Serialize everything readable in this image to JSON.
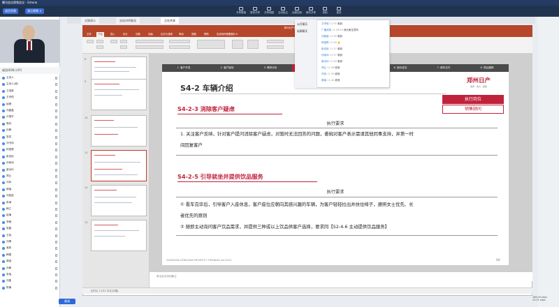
{
  "window": {
    "title": "腾讯会议视频会议 - Gstarw"
  },
  "topbar": {
    "left_buttons": [
      "成员列表",
      "演示视频 ×"
    ],
    "tools": [
      "共享屏幕",
      "暂停共享",
      "共享视图",
      "互动批注",
      "远程控制",
      "新的共享",
      "录制",
      "更多"
    ]
  },
  "left_panel": {
    "members_header": "成员(636) (47)",
    "members": [
      "主持人",
      "主持人(我)",
      "卫浩新",
      "王宗恒",
      "赵峰",
      "刘鑫鑫",
      "卢振宇",
      "周庆",
      "孙静",
      "张宏",
      "刘书伟",
      "柯宝根",
      "彭佳怡",
      "孙雨诗",
      "梁冰玲",
      "郑云",
      "刘伟",
      "郭蓓",
      "刘苗苗",
      "朱琦",
      "韩立",
      "赵楠",
      "李峰",
      "张磊",
      "王晓",
      "刘倩",
      "吴彬",
      "韩雪",
      "郭强",
      "孙峰",
      "张瑶",
      "刘星",
      "陈楠"
    ],
    "invite_button": "邀请"
  },
  "browser_tabs": [
    "文稿演示",
    "说说讲师解读",
    "正在共享"
  ],
  "ppt": {
    "window_title": "郑州日产销售顾问培训.pptx - PowerPoint",
    "ribbon_tabs": [
      "文件",
      "开始",
      "插入",
      "设计",
      "切换",
      "动画",
      "幻灯片放映",
      "审阅",
      "视图",
      "帮助",
      "告诉我你想要做什么"
    ],
    "slide_numbers": [
      "8",
      "9",
      "10",
      "11",
      "12",
      "13"
    ],
    "notes_placeholder": "单击此处添加备注",
    "status": "幻灯片 11/52   中文(中国)"
  },
  "slide": {
    "steps": [
      "1. 客户开发",
      "2. 客户接待",
      "3. 需求分析",
      "4. 产品介绍",
      "5. 试乘试驾",
      "6. 报价成交",
      "7. 新车交付",
      "8. 售后跟踪"
    ],
    "active_step": 3,
    "title": "S4-2 车辆介绍",
    "brand": "郑州日产",
    "brand_sub": "驰骋 · 敢为 · 超越",
    "role_header": "执行岗位",
    "role_value": "销售顾问",
    "section1_title": "S4-2-3 消除客户疑虑",
    "section1_req_label": "执行要求",
    "section1_text_line1": "1. 关注客户反映，针对客户提问消除客户疑虑，对暂时无法回答的问题，委婉对客户表示需请其他同事支持，并第一时",
    "section1_text_line2": "间回复客户",
    "section2_title": "S4-2-5 引导就坐并提供饮品服务",
    "section2_req_label": "执行要求",
    "section2_text_line1": "① 看车完毕后，引导客户入座休息，客户座位应朝向其感兴趣的车辆，为客户轻轻拉出并扶住椅子，遵照女士优先、长",
    "section2_text_line2": "者优先的原则",
    "section2_text_line3": "② 随即主动询问客户饮品需求，并提供三种或以上饮品供客户选择，要求同【S2-4-6 主动提供饮品服务】",
    "footer": "ZZNISSAN-ZZNISSAN-PROSPECT TRAINING-AA-0012",
    "page": "88"
  },
  "chat": {
    "side": [
      "公开聊天",
      "私聊聊天"
    ],
    "messages": [
      {
        "name": "王宗恒",
        "time": "11:35",
        "text": "收到"
      },
      {
        "name": "广播消息",
        "time": "11:36:50",
        "text": "请大家注意听"
      },
      {
        "name": "刘鑫鑫",
        "time": "11:36",
        "text": "收到"
      },
      {
        "name": "柯宝根",
        "time": "11:36",
        "text": "👍"
      },
      {
        "name": "彭佳怡",
        "time": "11:37",
        "text": "收到"
      },
      {
        "name": "孙雨诗",
        "time": "11:37",
        "text": "收到"
      },
      {
        "name": "梁冰玲",
        "time": "11:38",
        "text": "收到"
      },
      {
        "name": "郑云",
        "time": "11:38",
        "text": "收到"
      },
      {
        "name": "刘伟",
        "time": "11:39",
        "text": "收到"
      },
      {
        "name": "郭蓓",
        "time": "11:40",
        "text": "收到"
      }
    ]
  },
  "network": {
    "line1": "168.00 kbps",
    "line2": "24.01 kbps"
  },
  "colors": {
    "accent": "#c0223c",
    "ppt": "#b7472a",
    "meeting_bar": "#21344f"
  }
}
